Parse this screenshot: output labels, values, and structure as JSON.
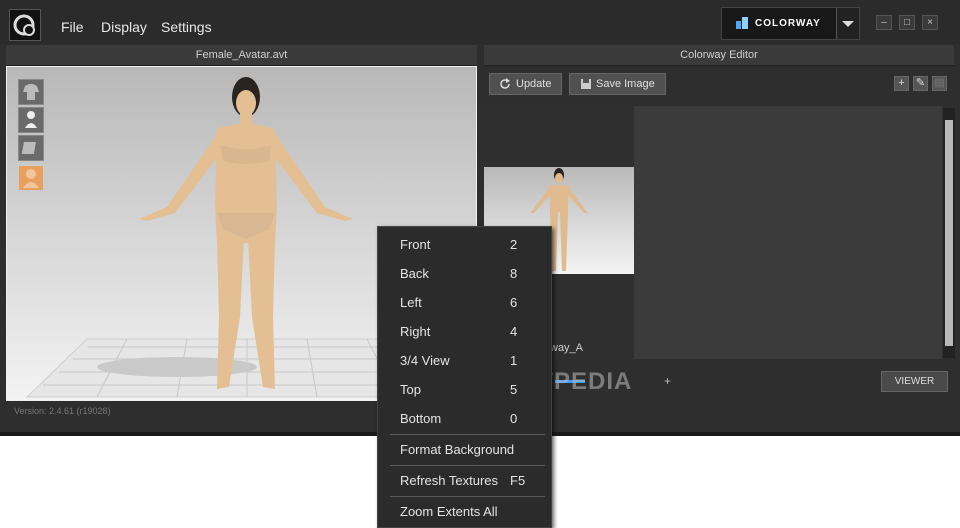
{
  "menubar": {
    "items": [
      "File",
      "Display",
      "Settings"
    ]
  },
  "colorway_button": {
    "label": "COLORWAY"
  },
  "window_controls": {
    "minimize": "–",
    "maximize": "□",
    "close": "×"
  },
  "left_panel": {
    "title": "Female_Avatar.avt",
    "version": "Version: 2.4.61     (r19028)"
  },
  "right_panel": {
    "title": "Colorway Editor",
    "update_label": "Update",
    "save_image_label": "Save Image",
    "thumbnail_label": "way_A",
    "viewer_label": "VIEWER",
    "zoom_plus": "+"
  },
  "context_menu": {
    "items": [
      {
        "label": "Front",
        "key": "2"
      },
      {
        "label": "Back",
        "key": "8"
      },
      {
        "label": "Left",
        "key": "6"
      },
      {
        "label": "Right",
        "key": "4"
      },
      {
        "label": "3/4 View",
        "key": "1"
      },
      {
        "label": "Top",
        "key": "5"
      },
      {
        "label": "Bottom",
        "key": "0"
      },
      {
        "label": "Format Background",
        "key": ""
      },
      {
        "label": "Refresh Textures",
        "key": "F5"
      },
      {
        "label": "Zoom Extents All",
        "key": ""
      }
    ]
  },
  "watermark": "SOFTPEDIA",
  "colors": {
    "accent": "#3aa0ff",
    "active_tool": "#e8a060"
  }
}
